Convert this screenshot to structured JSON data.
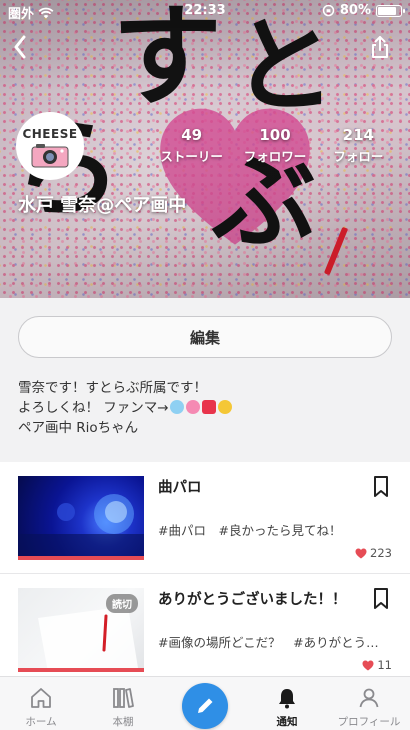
{
  "status_bar": {
    "carrier": "圏外",
    "time": "22:33",
    "battery": "80%",
    "battery_level": 0.8
  },
  "profile": {
    "name": "水戸 雪奈@ペア画中",
    "avatar_logo_text": "CHEESE",
    "stats": [
      {
        "num": "49",
        "label": "ストーリー"
      },
      {
        "num": "100",
        "label": "フォロワー"
      },
      {
        "num": "214",
        "label": "フォロー"
      }
    ],
    "edit_label": "編集",
    "bio": [
      "雪奈です！すとらぶ所属です！",
      "よろしくね！ ファンマ→",
      "ペア画中 Rioちゃん"
    ],
    "cover_text": [
      "す",
      "と",
      "ら",
      "ぶ"
    ]
  },
  "stories": [
    {
      "title": "曲パロ",
      "tags": "#曲パロ　#良かったら見てね！",
      "likes": "223",
      "badge": ""
    },
    {
      "title": "ありがとうございました！！",
      "tags": "#画像の場所どこだ？　#ありがとうご…",
      "likes": "11",
      "badge": "読切"
    }
  ],
  "tabs": [
    {
      "label": "ホーム",
      "icon": "home-icon"
    },
    {
      "label": "本棚",
      "icon": "bookshelf-icon"
    },
    {
      "label": "",
      "icon": "pencil-icon"
    },
    {
      "label": "通知",
      "icon": "bell-icon"
    },
    {
      "label": "プロフィール",
      "icon": "person-icon"
    }
  ],
  "colors": {
    "accent": "#2f8fe6",
    "like": "#e64c55"
  }
}
